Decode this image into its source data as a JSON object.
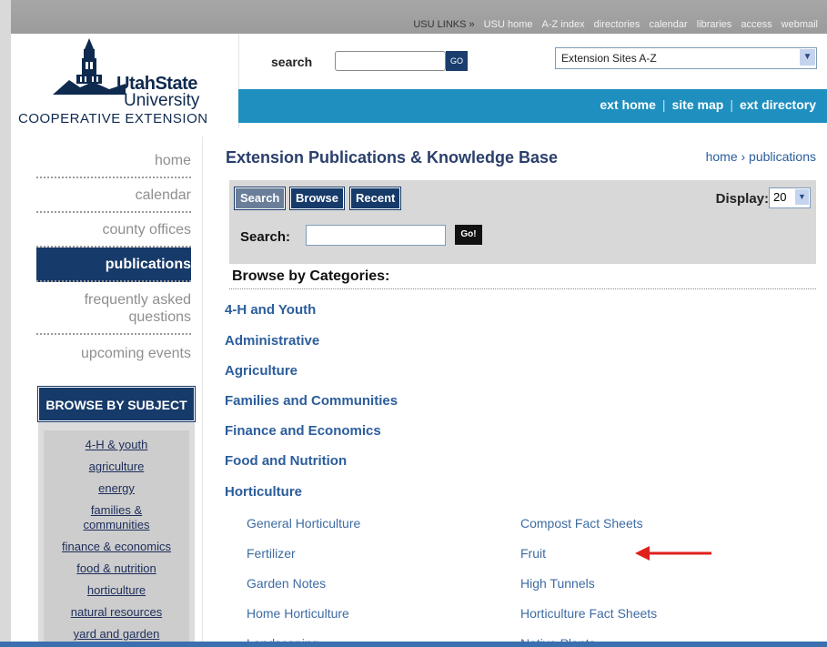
{
  "top_links": {
    "label": "USU LINKS »",
    "items": [
      "USU home",
      "A-Z index",
      "directories",
      "calendar",
      "libraries",
      "access",
      "webmail"
    ]
  },
  "logo": {
    "line1": "UtahState",
    "line2": "University",
    "line3": "COOPERATIVE EXTENSION"
  },
  "header_search": {
    "label": "search",
    "value": "",
    "go_label": "GO"
  },
  "sites_select": {
    "selected": "Extension Sites A-Z"
  },
  "header_links": [
    "ext home",
    "site map",
    "ext directory"
  ],
  "left_nav": [
    {
      "label": "home"
    },
    {
      "label": "calendar"
    },
    {
      "label": "county offices"
    },
    {
      "label": "publications"
    },
    {
      "label": "frequently asked questions"
    },
    {
      "label": "upcoming events"
    }
  ],
  "browse_subject": {
    "title": "BROWSE BY SUBJECT",
    "items": [
      "4-H & youth",
      "agriculture",
      "energy",
      "families & communities",
      "finance & economics",
      "food & nutrition",
      "horticulture",
      "natural resources",
      "yard and garden"
    ]
  },
  "main": {
    "title": "Extension Publications & Knowledge Base",
    "breadcrumb": "home › publications",
    "tabs": [
      "Search",
      "Browse",
      "Recent"
    ],
    "display_label": "Display:",
    "display_value": "20",
    "search_label": "Search:",
    "search_value": "",
    "go_label": "Go!",
    "browse_heading": "Browse by Categories:",
    "categories": [
      "4-H and Youth",
      "Administrative",
      "Agriculture",
      "Families and Communities",
      "Finance and Economics",
      "Food and Nutrition",
      "Horticulture"
    ],
    "horticulture_sub": [
      [
        "General Horticulture",
        "Compost Fact Sheets"
      ],
      [
        "Fertilizer",
        "Fruit"
      ],
      [
        "Garden Notes",
        "High Tunnels"
      ],
      [
        "Home Horticulture",
        "Horticulture Fact Sheets"
      ],
      [
        "Landscaping",
        "Native Plants"
      ]
    ]
  },
  "colors": {
    "navy": "#163a69",
    "header_blue": "#1f8fbf",
    "link_blue": "#2b5d9b",
    "annotation_red": "#e0201b"
  }
}
